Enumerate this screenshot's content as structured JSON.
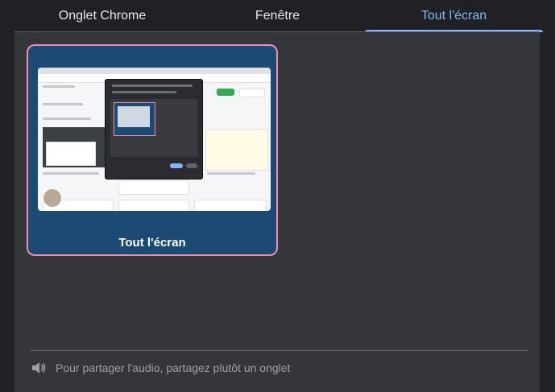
{
  "tabs": [
    {
      "label": "Onglet Chrome",
      "active": false
    },
    {
      "label": "Fenêtre",
      "active": false
    },
    {
      "label": "Tout l'écran",
      "active": true
    }
  ],
  "screen_options": [
    {
      "label": "Tout l'écran",
      "selected": true
    }
  ],
  "footer": {
    "icon": "speaker-icon",
    "text": "Pour partager l'audio, partagez plutôt un onglet"
  },
  "colors": {
    "accent": "#8ab4f8",
    "selection_border": "#f28bb6",
    "card_bg": "#1b4b73"
  }
}
